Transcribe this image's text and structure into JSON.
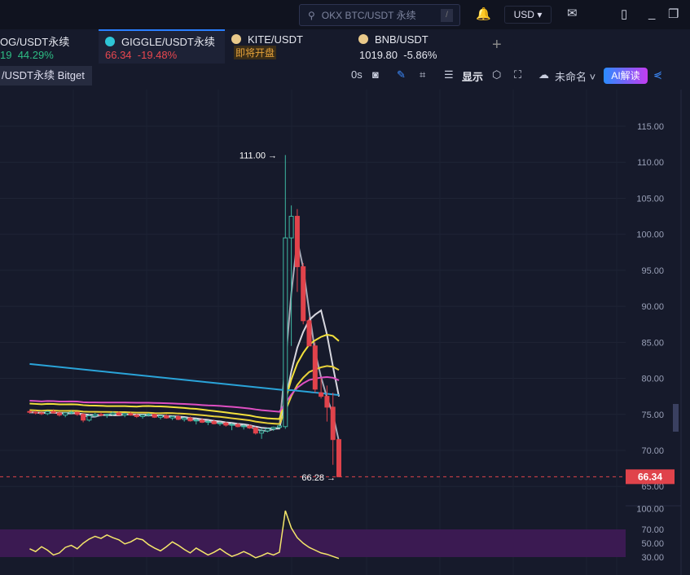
{
  "header": {
    "search_placeholder": "OKX BTC/USDT 永续",
    "search_shortcut": "/",
    "currency": "USD"
  },
  "tabs": [
    {
      "name": "OG/USDT永续",
      "price": "19",
      "change": "44.29%",
      "change_color": "#2ebd85"
    },
    {
      "name": "GIGGLE/USDT永续",
      "price": "66.34",
      "change": "-19.48%",
      "change_color": "#e8474f",
      "active": true
    },
    {
      "name": "KITE/USDT",
      "status": "即将开盘"
    },
    {
      "name": "BNB/USDT",
      "price": "1019.80",
      "change": "-5.86%"
    }
  ],
  "tooltip": "/USDT永续 Bitget",
  "toolbar": {
    "interval": "0s",
    "display": "显示",
    "layout_name": "未命名",
    "ai_label": "AI解读"
  },
  "colors": {
    "up": "#3fb8a3",
    "down": "#e0434b",
    "ma1": "#a9aab8",
    "ma2": "#d7d7df",
    "ma3": "#f2e03c",
    "ma4": "#e8d13a",
    "ma5": "#de4fc2",
    "ma6": "#2aa3d8",
    "rsi": "#f4e66a",
    "rsi_band": "#3b1a52"
  },
  "chart_data": {
    "type": "candlestick",
    "price_axis": {
      "ticks": [
        "115.00",
        "110.00",
        "105.00",
        "100.00",
        "95.00",
        "90.00",
        "85.00",
        "80.00",
        "75.00",
        "70.00",
        "65.00"
      ],
      "range": [
        64,
        118
      ]
    },
    "last_price": "66.34",
    "high_label": "111.00",
    "low_label": "66.28",
    "high": 111.0,
    "low": 66.28,
    "candles": [
      [
        75.4,
        75.6,
        75.1,
        75.3
      ],
      [
        75.3,
        75.5,
        75.0,
        75.2
      ],
      [
        75.2,
        75.4,
        74.9,
        75.1
      ],
      [
        75.1,
        75.5,
        74.9,
        75.4
      ],
      [
        75.4,
        75.7,
        75.1,
        75.2
      ],
      [
        75.2,
        75.4,
        74.7,
        74.9
      ],
      [
        74.9,
        75.3,
        74.6,
        75.2
      ],
      [
        75.2,
        75.5,
        75.0,
        75.3
      ],
      [
        75.3,
        75.4,
        74.8,
        75.0
      ],
      [
        75.0,
        75.2,
        73.9,
        74.2
      ],
      [
        74.2,
        75.0,
        74.0,
        74.8
      ],
      [
        74.8,
        75.2,
        74.6,
        75.0
      ],
      [
        75.0,
        75.3,
        74.7,
        74.9
      ],
      [
        74.9,
        75.1,
        74.5,
        75.0
      ],
      [
        75.0,
        75.4,
        74.8,
        75.2
      ],
      [
        75.2,
        75.4,
        74.8,
        74.9
      ],
      [
        74.9,
        75.2,
        74.6,
        75.1
      ],
      [
        75.1,
        75.3,
        74.8,
        74.9
      ],
      [
        74.9,
        75.1,
        74.5,
        74.7
      ],
      [
        74.7,
        75.0,
        74.4,
        74.9
      ],
      [
        74.9,
        75.2,
        74.7,
        75.0
      ],
      [
        75.0,
        75.1,
        74.5,
        74.6
      ],
      [
        74.6,
        74.9,
        74.3,
        74.8
      ],
      [
        74.8,
        75.0,
        74.4,
        74.5
      ],
      [
        74.5,
        74.8,
        74.2,
        74.7
      ],
      [
        74.7,
        74.9,
        74.2,
        74.3
      ],
      [
        74.3,
        74.6,
        74.0,
        74.5
      ],
      [
        74.5,
        74.7,
        74.0,
        74.1
      ],
      [
        74.1,
        74.4,
        73.6,
        74.2
      ],
      [
        74.2,
        74.5,
        73.8,
        73.9
      ],
      [
        73.9,
        74.2,
        73.5,
        74.0
      ],
      [
        74.0,
        74.3,
        73.6,
        73.7
      ],
      [
        73.7,
        74.0,
        73.4,
        73.8
      ],
      [
        73.8,
        74.0,
        73.3,
        73.5
      ],
      [
        73.5,
        73.8,
        72.8,
        73.6
      ],
      [
        73.6,
        73.8,
        73.2,
        73.3
      ],
      [
        73.3,
        73.6,
        72.9,
        73.4
      ],
      [
        73.4,
        73.6,
        73.0,
        73.1
      ],
      [
        73.1,
        73.3,
        72.2,
        72.4
      ],
      [
        72.4,
        73.1,
        71.6,
        72.7
      ],
      [
        72.7,
        73.1,
        72.5,
        73.0
      ],
      [
        73.0,
        73.3,
        72.7,
        73.2
      ],
      [
        73.2,
        73.6,
        73.0,
        73.4
      ],
      [
        73.3,
        111.0,
        73.0,
        99.5
      ],
      [
        99.5,
        104.0,
        84.5,
        102.5
      ],
      [
        102.5,
        103.5,
        92.0,
        95.5
      ],
      [
        95.5,
        96.0,
        87.5,
        88.0
      ],
      [
        88.0,
        88.5,
        84.5,
        84.5
      ],
      [
        84.5,
        85.0,
        78.0,
        78.5
      ],
      [
        78.0,
        80.0,
        77.2,
        77.5
      ],
      [
        77.5,
        79.0,
        74.0,
        76.0
      ],
      [
        76.0,
        78.0,
        68.0,
        71.5
      ],
      [
        71.5,
        71.6,
        66.28,
        66.34
      ]
    ],
    "rsi_axis": {
      "ticks": [
        "100.00",
        "70.00",
        "50.00",
        "30.00"
      ],
      "band": [
        30,
        70
      ]
    },
    "rsi": [
      42,
      38,
      45,
      40,
      33,
      36,
      44,
      47,
      42,
      50,
      56,
      60,
      57,
      62,
      58,
      55,
      49,
      52,
      57,
      55,
      48,
      43,
      39,
      45,
      52,
      47,
      41,
      36,
      43,
      38,
      33,
      37,
      42,
      36,
      31,
      34,
      38,
      34,
      29,
      32,
      36,
      33,
      37,
      97,
      72,
      58,
      50,
      44,
      40,
      36,
      34,
      31,
      28
    ]
  }
}
